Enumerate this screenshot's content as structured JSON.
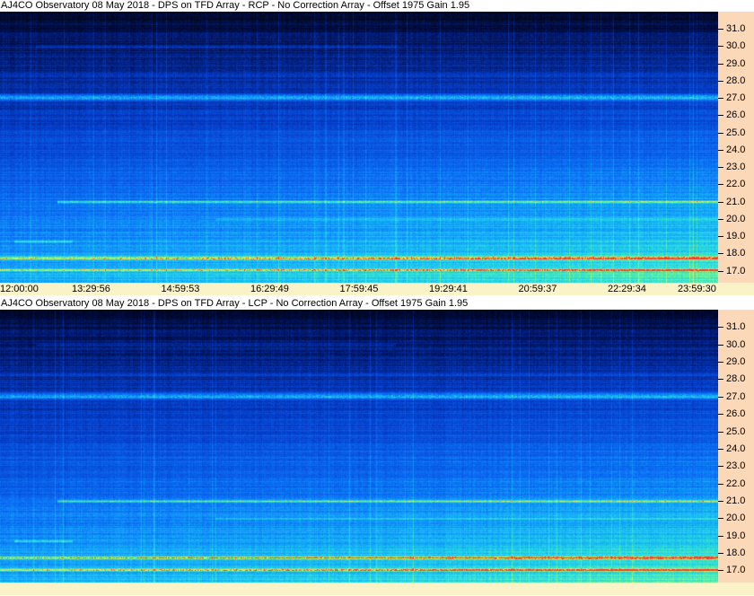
{
  "panels": [
    {
      "title": "AJ4CO Observatory 08 May 2018 - DPS on TFD Array  - RCP  -  No Correction Array  -  Offset 1975  Gain 1.95",
      "polarization": "RCP",
      "y_labels": [
        "31.0",
        "30.0",
        "29.0",
        "28.0",
        "27.0",
        "26.0",
        "25.0",
        "24.0",
        "23.0",
        "22.0",
        "21.0",
        "20.0",
        "19.0",
        "18.0",
        "17.0"
      ],
      "x_labels": [
        "12:00:00",
        "13:29:56",
        "14:59:53",
        "16:29:49",
        "17:59:45",
        "19:29:41",
        "20:59:37",
        "22:29:34",
        "23:59:30"
      ]
    },
    {
      "title": "AJ4CO Observatory 08 May 2018 - DPS on TFD Array  - LCP  -  No Correction Array  -  Offset 1975  Gain 1.95",
      "polarization": "LCP",
      "y_labels": [
        "31.0",
        "30.0",
        "29.0",
        "28.0",
        "27.0",
        "26.0",
        "25.0",
        "24.0",
        "23.0",
        "22.0",
        "21.0",
        "20.0",
        "19.0",
        "18.0",
        "17.0"
      ],
      "x_labels": []
    }
  ],
  "chart_data": [
    {
      "type": "heatmap",
      "title": "AJ4CO Observatory 08 May 2018 - DPS on TFD Array  - RCP  -  No Correction Array  -  Offset 1975  Gain 1.95",
      "x": [
        "12:00:00",
        "13:29:56",
        "14:59:53",
        "16:29:49",
        "17:59:45",
        "19:29:41",
        "20:59:37",
        "22:29:34",
        "23:59:30"
      ],
      "y": [
        31.0,
        30.0,
        29.0,
        28.0,
        27.0,
        26.0,
        25.0,
        24.0,
        23.0,
        22.0,
        21.0,
        20.0,
        19.0,
        18.0,
        17.0
      ],
      "ylim": [
        16.3,
        32.0
      ],
      "bright_bands": [
        27.0,
        21.0,
        17.8,
        17.0
      ],
      "colors": {
        "low": "#000820",
        "mid": "#0a5af0",
        "high": "#5ff08a",
        "peak": "#ff3030"
      }
    },
    {
      "type": "heatmap",
      "title": "AJ4CO Observatory 08 May 2018 - DPS on TFD Array  - LCP  -  No Correction Array  -  Offset 1975  Gain 1.95",
      "x": [
        "12:00:00",
        "13:29:56",
        "14:59:53",
        "16:29:49",
        "17:59:45",
        "19:29:41",
        "20:59:37",
        "22:29:34",
        "23:59:30"
      ],
      "y": [
        31.0,
        30.0,
        29.0,
        28.0,
        27.0,
        26.0,
        25.0,
        24.0,
        23.0,
        22.0,
        21.0,
        20.0,
        19.0,
        18.0,
        17.0
      ],
      "ylim": [
        16.3,
        32.0
      ],
      "bright_bands": [
        27.0,
        21.0,
        17.8,
        17.0
      ],
      "colors": {
        "low": "#000820",
        "mid": "#0a5af0",
        "high": "#5ff08a",
        "peak": "#ff3030"
      }
    }
  ]
}
